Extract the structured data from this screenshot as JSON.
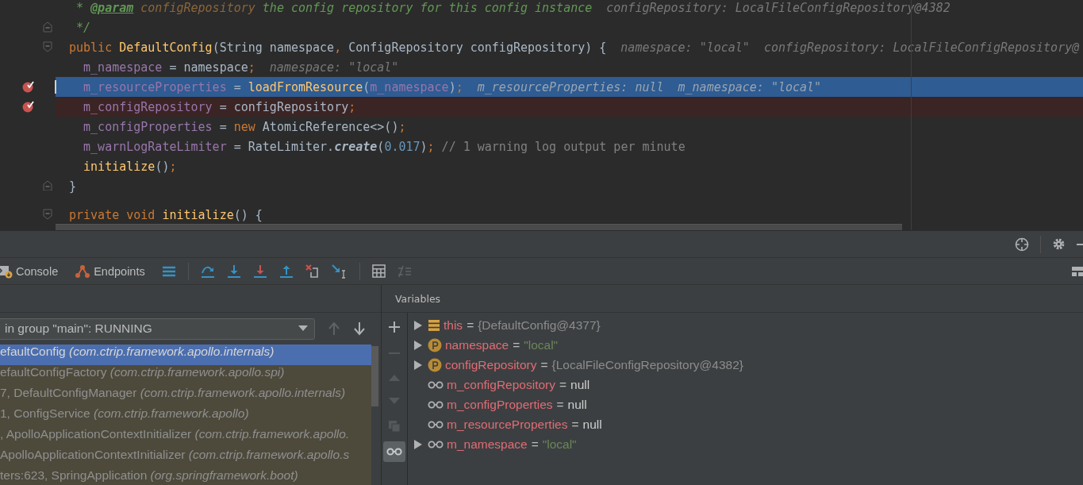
{
  "editor": {
    "lines": [
      {
        "tokens": [
          {
            "kind": "doc",
            "text": " * "
          },
          {
            "kind": "doctag",
            "text": "@param"
          },
          {
            "kind": "docparam",
            "text": " configRepository"
          },
          {
            "kind": "doc",
            "text": " the config repository for this config instance"
          }
        ],
        "hints": [
          "configRepository: LocalFileConfigRepository@4382"
        ]
      },
      {
        "tokens": [
          {
            "kind": "doc",
            "text": " */"
          }
        ],
        "fold": {
          "kind": "end"
        }
      },
      {
        "tokens": [
          {
            "kind": "keyword",
            "text": "public "
          },
          {
            "kind": "method",
            "text": "DefaultConfig"
          },
          {
            "kind": "plain",
            "text": "(String namespace"
          },
          {
            "kind": "punct",
            "text": ", "
          },
          {
            "kind": "plain",
            "text": "ConfigRepository configRepository) {"
          }
        ],
        "hints": [
          "namespace: \"local\"",
          "configRepository: LocalFileConfigRepository@"
        ],
        "fold": {
          "kind": "start"
        }
      },
      {
        "tokens": [
          {
            "kind": "field",
            "text": "  m_namespace"
          },
          {
            "kind": "plain",
            "text": " = namespace"
          },
          {
            "kind": "punct",
            "text": ";"
          }
        ],
        "hints": [
          "namespace: \"local\""
        ]
      },
      {
        "tokens": [
          {
            "kind": "field",
            "text": "  m_resourceProperties"
          },
          {
            "kind": "plain",
            "text": " = "
          },
          {
            "kind": "method",
            "text": "loadFromResource"
          },
          {
            "kind": "plain",
            "text": "("
          },
          {
            "kind": "field",
            "text": "m_namespace"
          },
          {
            "kind": "plain",
            "text": ")"
          },
          {
            "kind": "punct",
            "text": ";"
          }
        ],
        "hints": [
          "m_resourceProperties: null",
          "m_namespace: \"local\""
        ],
        "breakpoint": true,
        "execution": true
      },
      {
        "tokens": [
          {
            "kind": "field",
            "text": "  m_configRepository"
          },
          {
            "kind": "plain",
            "text": " = configRepository"
          },
          {
            "kind": "punct",
            "text": ";"
          }
        ],
        "breakpoint": true,
        "execution": false
      },
      {
        "tokens": [
          {
            "kind": "field",
            "text": "  m_configProperties"
          },
          {
            "kind": "plain",
            "text": " = "
          },
          {
            "kind": "keyword",
            "text": "new "
          },
          {
            "kind": "plain",
            "text": "AtomicReference<>()"
          },
          {
            "kind": "punct",
            "text": ";"
          }
        ]
      },
      {
        "tokens": [
          {
            "kind": "field",
            "text": "  m_warnLogRateLimiter"
          },
          {
            "kind": "plain",
            "text": " = RateLimiter."
          },
          {
            "kind": "static",
            "text": "create"
          },
          {
            "kind": "plain",
            "text": "("
          },
          {
            "kind": "number",
            "text": "0.017"
          },
          {
            "kind": "plain",
            "text": ")"
          },
          {
            "kind": "punct",
            "text": ";"
          },
          {
            "kind": "comment",
            "text": " // 1 warning log output per minute"
          }
        ]
      },
      {
        "tokens": [
          {
            "kind": "method",
            "text": "  initialize"
          },
          {
            "kind": "plain",
            "text": "()"
          },
          {
            "kind": "punct",
            "text": ";"
          }
        ]
      },
      {
        "tokens": [
          {
            "kind": "plain",
            "text": "}"
          }
        ],
        "fold": {
          "kind": "end"
        }
      },
      {
        "kind": "blank"
      },
      {
        "tokens": [
          {
            "kind": "keyword",
            "text": "private void "
          },
          {
            "kind": "method",
            "text": "initialize"
          },
          {
            "kind": "plain",
            "text": "() {"
          }
        ],
        "fold": {
          "kind": "start"
        }
      }
    ]
  },
  "debugger": {
    "tabs": [
      {
        "kind": "console",
        "label": "Console"
      },
      {
        "kind": "endpoints",
        "label": "Endpoints"
      }
    ],
    "thread": "in group \"main\": RUNNING",
    "frames": [
      {
        "method": "efaultConfig",
        "location": "(com.ctrip.framework.apollo.internals)",
        "selected": true
      },
      {
        "method": "efaultConfigFactory",
        "location": "(com.ctrip.framework.apollo.spi)",
        "selected": false
      },
      {
        "method": "7, DefaultConfigManager",
        "location": "(com.ctrip.framework.apollo.internals)",
        "selected": false
      },
      {
        "method": "1, ConfigService",
        "location": "(com.ctrip.framework.apollo)",
        "selected": false
      },
      {
        "method": ", ApolloApplicationContextInitializer",
        "location": "(com.ctrip.framework.apollo.",
        "selected": false
      },
      {
        "method": "ApolloApplicationContextInitializer",
        "location": "(com.ctrip.framework.apollo.s",
        "selected": false
      },
      {
        "method": "ters:623, SpringApplication",
        "location": "(org.springframework.boot)",
        "selected": false
      }
    ],
    "variables_title": "Variables",
    "variables": [
      {
        "kind": "object",
        "expandable": true,
        "name": "this",
        "operator": "=",
        "value": {
          "kind": "object",
          "text": "{DefaultConfig@4377}"
        }
      },
      {
        "kind": "param",
        "expandable": true,
        "name": "namespace",
        "operator": "=",
        "value": {
          "kind": "string",
          "text": "\"local\""
        }
      },
      {
        "kind": "param",
        "expandable": true,
        "name": "configRepository",
        "operator": "=",
        "value": {
          "kind": "object",
          "text": "{LocalFileConfigRepository@4382}"
        }
      },
      {
        "kind": "watch",
        "expandable": false,
        "name": "m_configRepository",
        "operator": "=",
        "value": {
          "kind": "null",
          "text": "null"
        }
      },
      {
        "kind": "watch",
        "expandable": false,
        "name": "m_configProperties",
        "operator": "=",
        "value": {
          "kind": "null",
          "text": "null"
        }
      },
      {
        "kind": "watch",
        "expandable": false,
        "name": "m_resourceProperties",
        "operator": "=",
        "value": {
          "kind": "null",
          "text": "null"
        }
      },
      {
        "kind": "watch",
        "expandable": true,
        "name": "m_namespace",
        "operator": "=",
        "value": {
          "kind": "string",
          "text": "\"local\""
        }
      }
    ]
  }
}
